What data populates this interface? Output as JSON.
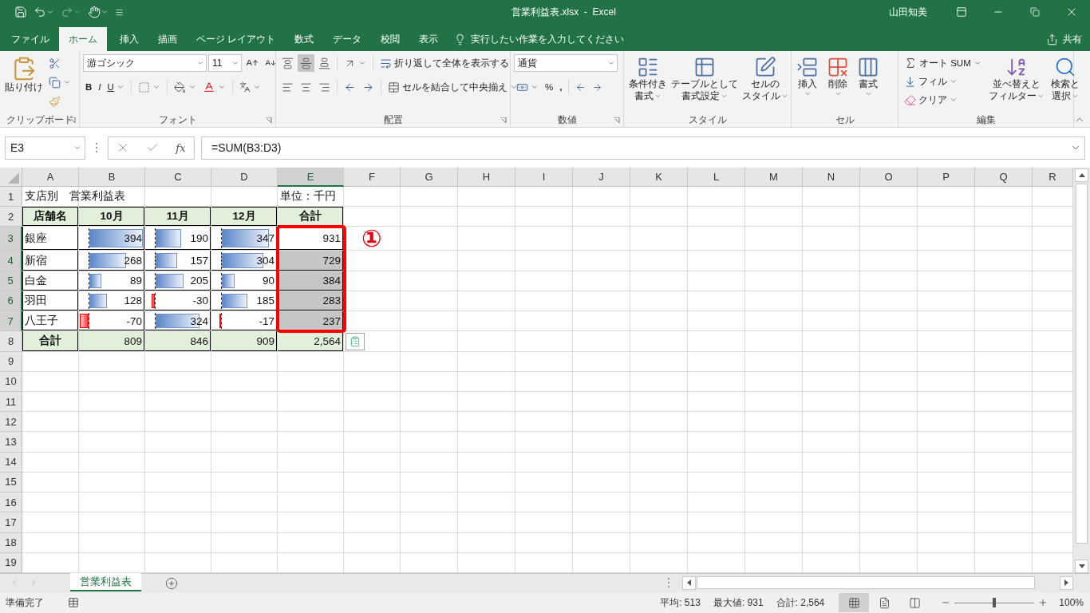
{
  "window": {
    "title": "営業利益表.xlsx  -  Excel",
    "user": "山田知美"
  },
  "tabs": [
    {
      "label": "ファイル",
      "selected": false
    },
    {
      "label": "ホーム",
      "selected": true
    },
    {
      "label": "挿入",
      "selected": false
    },
    {
      "label": "描画",
      "selected": false
    },
    {
      "label": "ページ レイアウト",
      "selected": false
    },
    {
      "label": "数式",
      "selected": false
    },
    {
      "label": "データ",
      "selected": false
    },
    {
      "label": "校閲",
      "selected": false
    },
    {
      "label": "表示",
      "selected": false
    }
  ],
  "tell_me": {
    "placeholder": "実行したい作業を入力してください"
  },
  "share": "共有",
  "ribbon": {
    "clipboard": {
      "label": "クリップボード",
      "paste": "貼り付け"
    },
    "font": {
      "label": "フォント",
      "font_name": "游ゴシック",
      "font_size": "11",
      "bold": "B",
      "italic": "I",
      "underline": "U"
    },
    "alignment": {
      "label": "配置",
      "vertical": [
        {
          "selected": false
        },
        {
          "selected": true
        },
        {
          "selected": false
        }
      ],
      "wrap": "折り返して全体を表示する",
      "merge": "セルを結合して中央揃え"
    },
    "number": {
      "label": "数値",
      "format": "通貨",
      "percent": "%",
      "comma": ","
    },
    "styles": {
      "label": "スタイル",
      "buttons": [
        [
          "条件付き",
          "書式"
        ],
        [
          "テーブルとして",
          "書式設定"
        ],
        [
          "セルの",
          "スタイル"
        ]
      ]
    },
    "cells": {
      "label": "セル",
      "buttons": [
        "挿入",
        "削除",
        "書式"
      ]
    },
    "editing": {
      "label": "編集",
      "autosum": "オート SUM",
      "fill": "フィル",
      "clear": "クリア",
      "sort": [
        "並べ替えと",
        "フィルター"
      ],
      "find": [
        "検索と",
        "選択"
      ]
    }
  },
  "formula_bar": {
    "name_box": "E3",
    "fx": "fx",
    "formula": "=SUM(B3:D3)"
  },
  "columns": [
    {
      "label": "A",
      "selected": false
    },
    {
      "label": "B",
      "selected": false
    },
    {
      "label": "C",
      "selected": false
    },
    {
      "label": "D",
      "selected": false
    },
    {
      "label": "E",
      "selected": true
    },
    {
      "label": "F",
      "selected": false
    },
    {
      "label": "G",
      "selected": false
    },
    {
      "label": "H",
      "selected": false
    },
    {
      "label": "I",
      "selected": false
    },
    {
      "label": "J",
      "selected": false
    },
    {
      "label": "K",
      "selected": false
    },
    {
      "label": "L",
      "selected": false
    },
    {
      "label": "M",
      "selected": false
    },
    {
      "label": "N",
      "selected": false
    },
    {
      "label": "O",
      "selected": false
    },
    {
      "label": "P",
      "selected": false
    },
    {
      "label": "Q",
      "selected": false
    },
    {
      "label": "R",
      "selected": false
    }
  ],
  "rows": [
    {
      "header": "1",
      "selected": false,
      "kind": "title",
      "cells": [
        {
          "text": "支店別　営業利益表",
          "selected": false
        },
        {
          "selected": false
        },
        {
          "selected": false
        },
        {
          "selected": false
        },
        {
          "text": "単位：千円",
          "selected": false
        }
      ]
    },
    {
      "header": "2",
      "selected": false,
      "kind": "header",
      "cells": [
        {
          "text": "店舗名",
          "selected": false
        },
        {
          "text": "10月",
          "selected": false
        },
        {
          "text": "11月",
          "selected": false
        },
        {
          "text": "12月",
          "selected": false
        },
        {
          "text": "合計",
          "selected": false
        }
      ]
    },
    {
      "header": "3",
      "selected": true,
      "kind": "data",
      "cells": [
        {
          "text": "銀座",
          "selected": false
        },
        {
          "text": "394",
          "selected": false,
          "data_bar": true
        },
        {
          "text": "190",
          "selected": false,
          "data_bar": true
        },
        {
          "text": "347",
          "selected": false,
          "data_bar": true
        },
        {
          "text": "931",
          "selected": true
        }
      ]
    },
    {
      "header": "4",
      "selected": true,
      "kind": "data",
      "cells": [
        {
          "text": "新宿",
          "selected": false
        },
        {
          "text": "268",
          "selected": false,
          "data_bar": true
        },
        {
          "text": "157",
          "selected": false,
          "data_bar": true
        },
        {
          "text": "304",
          "selected": false,
          "data_bar": true
        },
        {
          "text": "729",
          "selected": true
        }
      ]
    },
    {
      "header": "5",
      "selected": true,
      "kind": "data",
      "cells": [
        {
          "text": "白金",
          "selected": false
        },
        {
          "text": "89",
          "selected": false,
          "data_bar": true
        },
        {
          "text": "205",
          "selected": false,
          "data_bar": true
        },
        {
          "text": "90",
          "selected": false,
          "data_bar": true
        },
        {
          "text": "384",
          "selected": true
        }
      ]
    },
    {
      "header": "6",
      "selected": true,
      "kind": "data",
      "cells": [
        {
          "text": "羽田",
          "selected": false
        },
        {
          "text": "128",
          "selected": false,
          "data_bar": true
        },
        {
          "text": "-30",
          "selected": false,
          "data_bar": true
        },
        {
          "text": "185",
          "selected": false,
          "data_bar": true
        },
        {
          "text": "283",
          "selected": true
        }
      ]
    },
    {
      "header": "7",
      "selected": true,
      "kind": "data",
      "cells": [
        {
          "text": "八王子",
          "selected": false
        },
        {
          "text": "-70",
          "selected": false,
          "data_bar": true
        },
        {
          "text": "324",
          "selected": false,
          "data_bar": true
        },
        {
          "text": "-17",
          "selected": false,
          "data_bar": true
        },
        {
          "text": "237",
          "selected": true
        }
      ]
    },
    {
      "header": "8",
      "selected": false,
      "kind": "total",
      "cells": [
        {
          "text": "合計",
          "selected": false
        },
        {
          "text": "809",
          "selected": false
        },
        {
          "text": "846",
          "selected": false
        },
        {
          "text": "909",
          "selected": false
        },
        {
          "text": "2,564",
          "selected": false
        }
      ]
    },
    {
      "header": "9",
      "selected": false
    },
    {
      "header": "10",
      "selected": false
    },
    {
      "header": "11",
      "selected": false
    },
    {
      "header": "12",
      "selected": false
    },
    {
      "header": "13",
      "selected": false
    },
    {
      "header": "14",
      "selected": false
    },
    {
      "header": "15",
      "selected": false
    },
    {
      "header": "16",
      "selected": false
    },
    {
      "header": "17",
      "selected": false
    },
    {
      "header": "18",
      "selected": false
    },
    {
      "header": "19",
      "selected": false
    }
  ],
  "annotation": {
    "label": "①",
    "frame": true
  },
  "sheets": [
    {
      "label": "営業利益表",
      "selected": true
    }
  ],
  "status_bar": {
    "mode": "準備完了",
    "stats": [
      "平均: 513",
      "最大値: 931",
      "合計: 2,564"
    ],
    "views": [
      {
        "selected": true
      },
      {
        "selected": false
      },
      {
        "selected": false
      }
    ],
    "zoom": {
      "level": 0.5,
      "reading": "100%"
    }
  }
}
